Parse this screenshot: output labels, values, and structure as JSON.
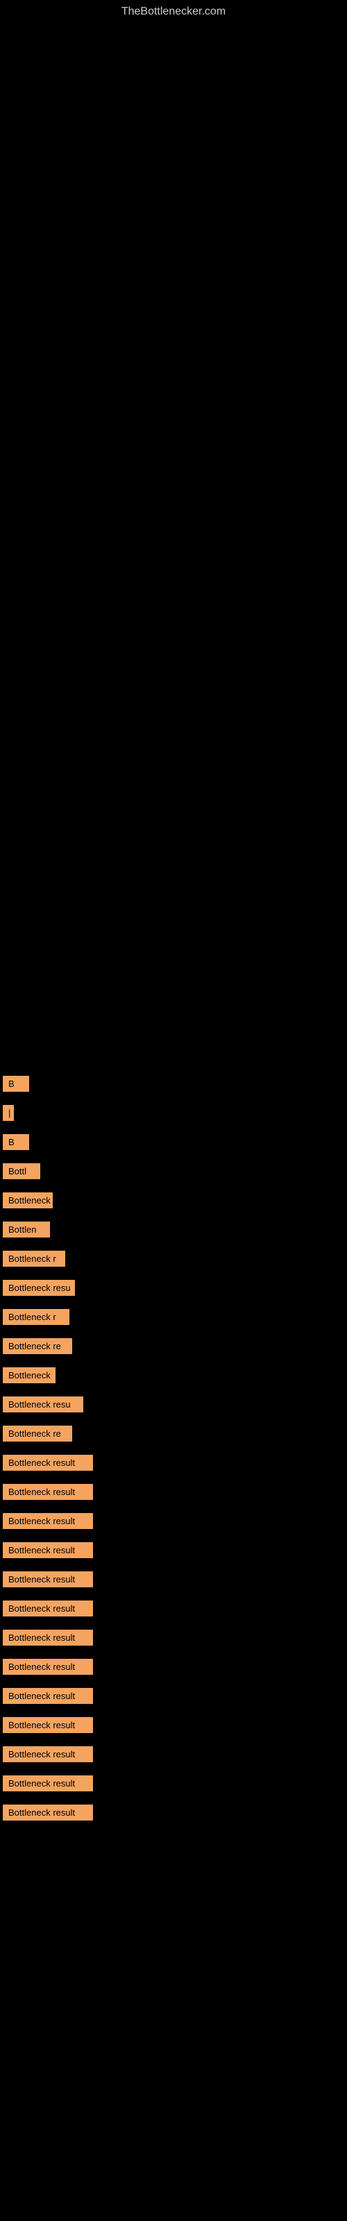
{
  "site": {
    "title": "TheBottlenecker.com"
  },
  "items": [
    {
      "id": 1,
      "label": "B"
    },
    {
      "id": 2,
      "label": "|"
    },
    {
      "id": 3,
      "label": "B"
    },
    {
      "id": 4,
      "label": "Bottl"
    },
    {
      "id": 5,
      "label": "Bottleneck"
    },
    {
      "id": 6,
      "label": "Bottlen"
    },
    {
      "id": 7,
      "label": "Bottleneck r"
    },
    {
      "id": 8,
      "label": "Bottleneck resu"
    },
    {
      "id": 9,
      "label": "Bottleneck r"
    },
    {
      "id": 10,
      "label": "Bottleneck re"
    },
    {
      "id": 11,
      "label": "Bottleneck"
    },
    {
      "id": 12,
      "label": "Bottleneck resu"
    },
    {
      "id": 13,
      "label": "Bottleneck re"
    },
    {
      "id": 14,
      "label": "Bottleneck result"
    },
    {
      "id": 15,
      "label": "Bottleneck result"
    },
    {
      "id": 16,
      "label": "Bottleneck result"
    },
    {
      "id": 17,
      "label": "Bottleneck result"
    },
    {
      "id": 18,
      "label": "Bottleneck result"
    },
    {
      "id": 19,
      "label": "Bottleneck result"
    },
    {
      "id": 20,
      "label": "Bottleneck result"
    },
    {
      "id": 21,
      "label": "Bottleneck result"
    },
    {
      "id": 22,
      "label": "Bottleneck result"
    },
    {
      "id": 23,
      "label": "Bottleneck result"
    },
    {
      "id": 24,
      "label": "Bottleneck result"
    },
    {
      "id": 25,
      "label": "Bottleneck result"
    },
    {
      "id": 26,
      "label": "Bottleneck result"
    }
  ]
}
